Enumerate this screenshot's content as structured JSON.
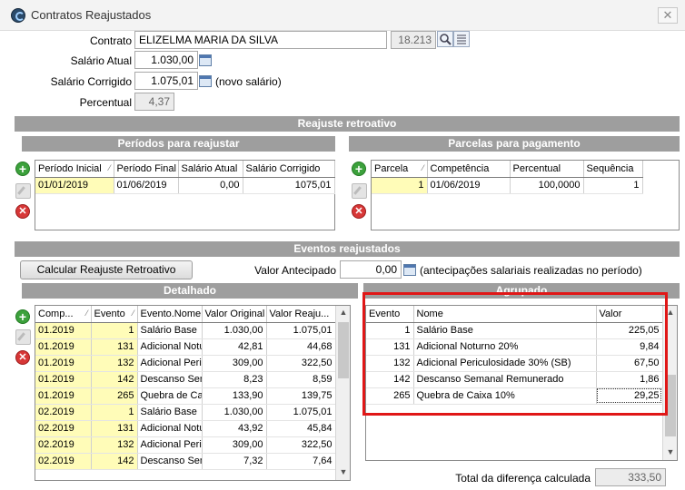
{
  "window": {
    "title": "Contratos Reajustados",
    "close_glyph": "✕"
  },
  "form": {
    "contrato_label": "Contrato",
    "contrato_name": "ELIZELMA MARIA DA SILVA",
    "contrato_code": "18.213",
    "salario_atual_label": "Salário Atual",
    "salario_atual": "1.030,00",
    "salario_corrigido_label": "Salário Corrigido",
    "salario_corrigido": "1.075,01",
    "novo_salario_note": "(novo salário)",
    "percentual_label": "Percentual",
    "percentual": "4,37"
  },
  "reajuste": {
    "title": "Reajuste retroativo",
    "periodos": {
      "title": "Períodos para reajustar",
      "columns": [
        "Período Inicial",
        "Período Final",
        "Salário Atual",
        "Salário Corrigido"
      ],
      "rows": [
        [
          "01/01/2019",
          "01/06/2019",
          "0,00",
          "1075,01"
        ]
      ]
    },
    "parcelas": {
      "title": "Parcelas para pagamento",
      "columns": [
        "Parcela",
        "Competência",
        "Percentual",
        "Sequência"
      ],
      "rows": [
        [
          "1",
          "01/06/2019",
          "100,0000",
          "1"
        ]
      ]
    }
  },
  "eventos": {
    "title": "Eventos reajustados",
    "calc_button": "Calcular Reajuste Retroativo",
    "valor_antecipado_label": "Valor Antecipado",
    "valor_antecipado": "0,00",
    "antecipacoes_note": "(antecipações salariais realizadas no período)",
    "detalhado": {
      "title": "Detalhado",
      "columns": [
        "Comp...",
        "Evento",
        "Evento.Nome",
        "Valor Original",
        "Valor Reaju..."
      ],
      "rows": [
        [
          "01.2019",
          "1",
          "Salário Base",
          "1.030,00",
          "1.075,01"
        ],
        [
          "01.2019",
          "131",
          "Adicional Notu",
          "42,81",
          "44,68"
        ],
        [
          "01.2019",
          "132",
          "Adicional Peric",
          "309,00",
          "322,50"
        ],
        [
          "01.2019",
          "142",
          "Descanso Sem",
          "8,23",
          "8,59"
        ],
        [
          "01.2019",
          "265",
          "Quebra de Cai",
          "133,90",
          "139,75"
        ],
        [
          "02.2019",
          "1",
          "Salário Base",
          "1.030,00",
          "1.075,01"
        ],
        [
          "02.2019",
          "131",
          "Adicional Notu",
          "43,92",
          "45,84"
        ],
        [
          "02.2019",
          "132",
          "Adicional Peric",
          "309,00",
          "322,50"
        ],
        [
          "02.2019",
          "142",
          "Descanso Sem",
          "7,32",
          "7,64"
        ]
      ]
    },
    "agrupado": {
      "title": "Agrupado",
      "columns": [
        "Evento",
        "Nome",
        "Valor"
      ],
      "rows": [
        [
          "1",
          "Salário Base",
          "225,05"
        ],
        [
          "131",
          "Adicional Noturno 20%",
          "9,84"
        ],
        [
          "132",
          "Adicional Periculosidade 30% (SB)",
          "67,50"
        ],
        [
          "142",
          "Descanso Semanal Remunerado",
          "1,86"
        ],
        [
          "265",
          "Quebra de Caixa 10%",
          "29,25"
        ]
      ]
    },
    "total_label": "Total da diferença calculada",
    "total_value": "333,50"
  },
  "glyphs": {
    "add": "+",
    "del": "✕",
    "up": "▲",
    "down": "▼",
    "sort": "⁄"
  },
  "icons": {
    "search": "search-icon",
    "list": "list-icon",
    "calendar": "calendar-icon",
    "add": "add-icon",
    "edit": "edit-icon",
    "delete": "delete-icon"
  },
  "colors": {
    "section_header": "#9e9e9e",
    "highlight_cell": "#fffcb8",
    "red_outline": "#e01717",
    "add_green": "#3ca13c",
    "delete_red": "#d73737"
  }
}
